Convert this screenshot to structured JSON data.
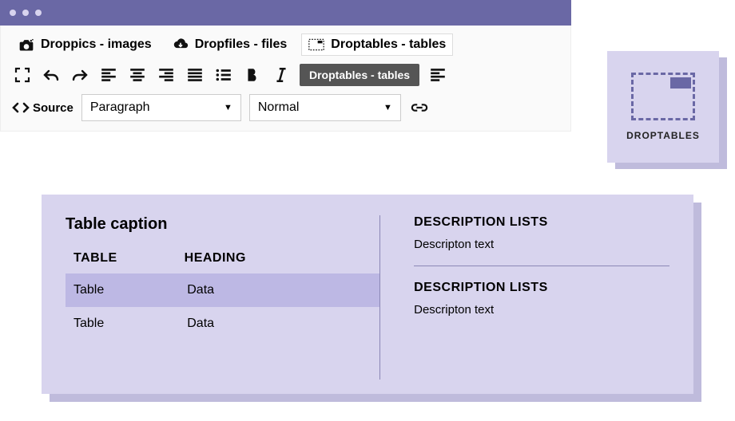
{
  "tabs": {
    "droppics": "Droppics - images",
    "dropfiles": "Dropfiles - files",
    "droptables": "Droptables - tables"
  },
  "tooltip": "Droptables - tables",
  "source_label": "Source",
  "select_block": "Paragraph",
  "select_style": "Normal",
  "card_label": "DROPTABLES",
  "table": {
    "caption": "Table caption",
    "head": {
      "c1": "TABLE",
      "c2": "HEADING"
    },
    "rows": [
      {
        "c1": "Table",
        "c2": "Data"
      },
      {
        "c1": "Table",
        "c2": "Data"
      }
    ]
  },
  "dlists": [
    {
      "title": "DESCRIPTION LISTS",
      "text": "Descripton text"
    },
    {
      "title": "DESCRIPTION LISTS",
      "text": "Descripton text"
    }
  ]
}
